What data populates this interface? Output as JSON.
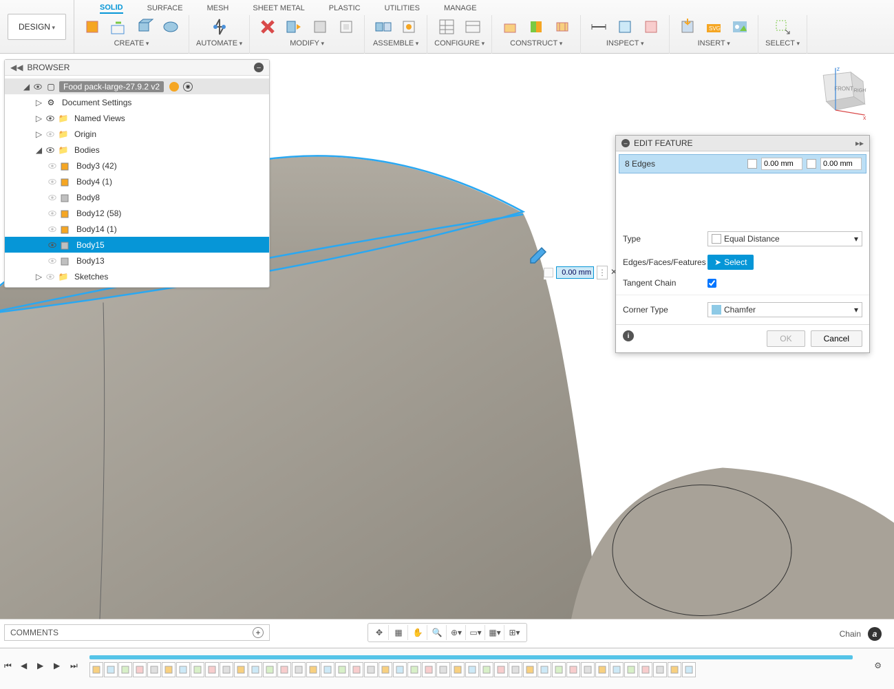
{
  "workspace": {
    "button": "DESIGN"
  },
  "tabs": [
    "SOLID",
    "SURFACE",
    "MESH",
    "SHEET METAL",
    "PLASTIC",
    "UTILITIES",
    "MANAGE"
  ],
  "activeTab": 0,
  "ribbonGroups": [
    {
      "label": "CREATE",
      "icons": 4
    },
    {
      "label": "AUTOMATE",
      "icons": 1
    },
    {
      "label": "MODIFY",
      "icons": 4
    },
    {
      "label": "ASSEMBLE",
      "icons": 2
    },
    {
      "label": "CONFIGURE",
      "icons": 2
    },
    {
      "label": "CONSTRUCT",
      "icons": 3
    },
    {
      "label": "INSPECT",
      "icons": 3
    },
    {
      "label": "INSERT",
      "icons": 3
    },
    {
      "label": "SELECT",
      "icons": 1
    }
  ],
  "browser": {
    "title": "BROWSER",
    "doc": "Food pack-large-27.9.2 v2",
    "items": [
      {
        "label": "Document Settings",
        "kind": "settings"
      },
      {
        "label": "Named Views",
        "kind": "folder"
      },
      {
        "label": "Origin",
        "kind": "folder",
        "hidden": true
      },
      {
        "label": "Bodies",
        "kind": "folder",
        "expanded": true
      }
    ],
    "bodies": [
      {
        "label": "Body3 (42)",
        "color": "orange",
        "hidden": true
      },
      {
        "label": "Body4 (1)",
        "color": "orange",
        "hidden": true
      },
      {
        "label": "Body8",
        "color": "gray",
        "hidden": true
      },
      {
        "label": "Body12 (58)",
        "color": "orange",
        "hidden": true
      },
      {
        "label": "Body14 (1)",
        "color": "orange",
        "hidden": true
      },
      {
        "label": "Body15",
        "color": "gray",
        "selected": true
      },
      {
        "label": "Body13",
        "color": "gray",
        "hidden": true
      }
    ],
    "sketches": {
      "label": "Sketches"
    }
  },
  "floatingInput": {
    "value": "0.00 mm"
  },
  "dialog": {
    "title": "EDIT FEATURE",
    "edgesLabel": "8 Edges",
    "dist1": "0.00 mm",
    "dist2": "0.00 mm",
    "typeLabel": "Type",
    "typeValue": "Equal Distance",
    "edgesFFLabel": "Edges/Faces/Features",
    "selectBtn": "Select",
    "tangentLabel": "Tangent Chain",
    "tangentChecked": true,
    "cornerLabel": "Corner Type",
    "cornerValue": "Chamfer",
    "okBtn": "OK",
    "cancelBtn": "Cancel"
  },
  "comments": {
    "title": "COMMENTS"
  },
  "statusRight": {
    "label": "Chain"
  },
  "viewcube": {
    "front": "FRONT",
    "right": "RIGHT"
  },
  "timelineCount": 42
}
